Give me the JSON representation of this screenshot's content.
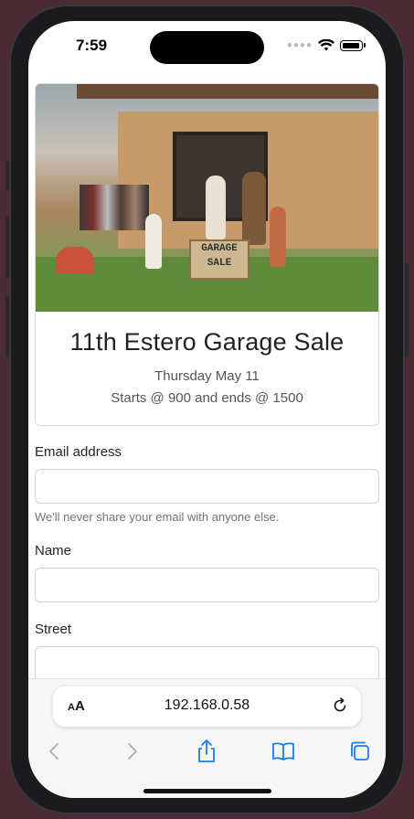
{
  "status": {
    "time": "7:59"
  },
  "event": {
    "title": "11th Estero Garage Sale",
    "date": "Thursday May 11",
    "hours": "Starts @ 900 and ends @ 1500",
    "sign_text_line1": "GARAGE",
    "sign_text_line2": "SALE"
  },
  "form": {
    "email_label": "Email address",
    "email_value": "",
    "email_help": "We'll never share your email with anyone else.",
    "name_label": "Name",
    "name_value": "",
    "street_label": "Street",
    "street_value": ""
  },
  "browser": {
    "text_size_label": "AA",
    "url": "192.168.0.58",
    "icons": [
      "back-icon",
      "forward-icon",
      "share-icon",
      "bookmarks-icon",
      "tabs-icon",
      "reload-icon"
    ]
  },
  "colors": {
    "accent": "#1a7cf5",
    "disabled": "#b5b5b5"
  }
}
